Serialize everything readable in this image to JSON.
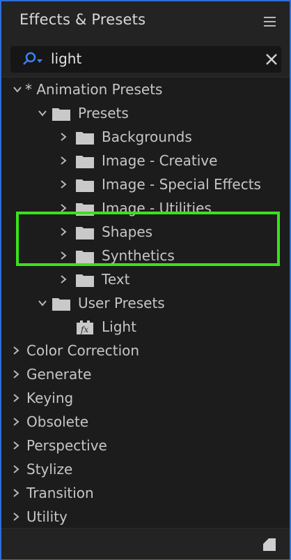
{
  "panel": {
    "title": "Effects & Presets"
  },
  "search": {
    "value": "light"
  },
  "tree": {
    "animation_presets": "* Animation Presets",
    "presets": "Presets",
    "preset_folders": [
      "Backgrounds",
      "Image - Creative",
      "Image - Special Effects",
      "Image - Utilities",
      "Shapes",
      "Synthetics",
      "Text"
    ],
    "user_presets": "User Presets",
    "user_preset_item": "Light",
    "categories": [
      "Color Correction",
      "Generate",
      "Keying",
      "Obsolete",
      "Perspective",
      "Stylize",
      "Transition",
      "Utility"
    ]
  },
  "colors": {
    "highlight": "#38e21a",
    "border": "#2f6fd6",
    "search_icon": "#3b82f6"
  }
}
